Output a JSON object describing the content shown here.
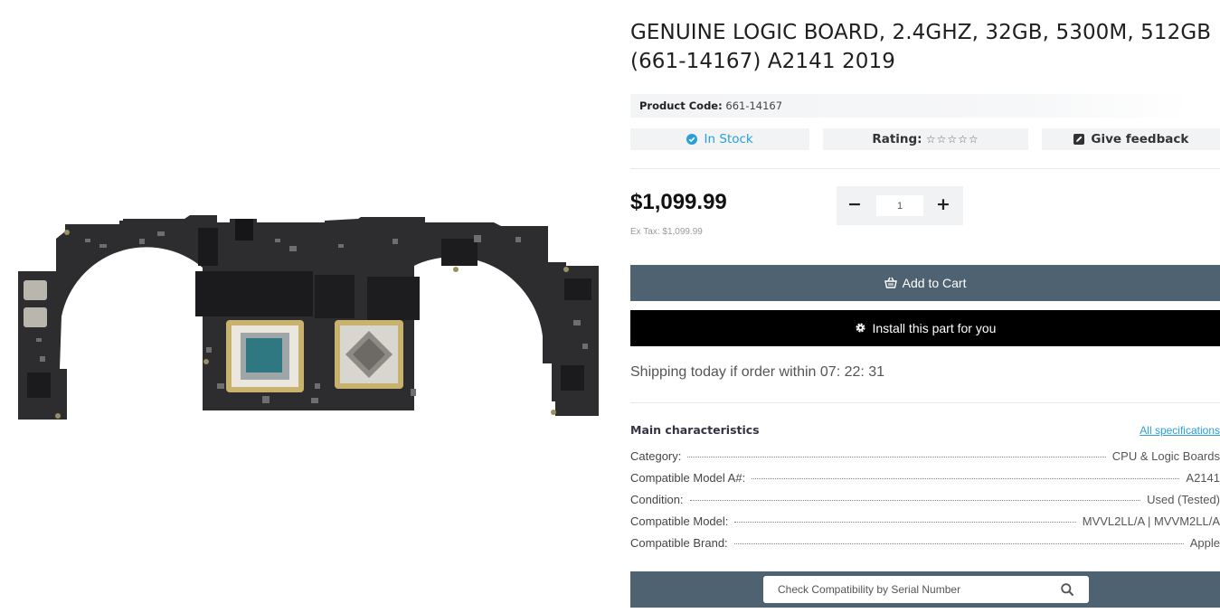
{
  "product": {
    "title": "GENUINE LOGIC BOARD, 2.4GHZ, 32GB, 5300M, 512GB (661-14167) A2141 2019",
    "code_label": "Product Code:",
    "code_value": "661-14167"
  },
  "status": {
    "stock": "In Stock",
    "rating_label": "Rating:",
    "rating_stars": "☆☆☆☆☆",
    "rating_value": 0,
    "feedback": "Give feedback"
  },
  "pricing": {
    "price": "$1,099.99",
    "ex_tax": "Ex Tax: $1,099.99"
  },
  "quantity": {
    "minus": "−",
    "plus": "+",
    "value": "1"
  },
  "actions": {
    "add_to_cart": "Add to Cart",
    "install": "Install this part for you"
  },
  "shipping": {
    "text": "Shipping today if order within",
    "countdown": "07: 22: 31"
  },
  "characteristics": {
    "heading": "Main characteristics",
    "all_specs": "All specifications",
    "rows": [
      {
        "label": "Category:",
        "value": "CPU & Logic Boards"
      },
      {
        "label": "Compatible Model A#:",
        "value": "A2141"
      },
      {
        "label": "Condition:",
        "value": "Used (Tested)"
      },
      {
        "label": "Compatible Model:",
        "value": "MVVL2LL/A | MVVM2LL/A"
      },
      {
        "label": "Compatible Brand:",
        "value": "Apple"
      }
    ]
  },
  "serial": {
    "placeholder": "Check Compatibility by Serial Number"
  },
  "colors": {
    "accent": "#2a9fd6",
    "button_slate": "#4f6271",
    "install_black": "#000000",
    "board_dark": "#2b2b2d",
    "chip_gold": "#d8c27a"
  },
  "icons": {
    "stock": "check-circle-icon",
    "feedback": "edit-square-icon",
    "cart": "basket-icon",
    "install": "gear-icon",
    "search": "search-icon"
  }
}
